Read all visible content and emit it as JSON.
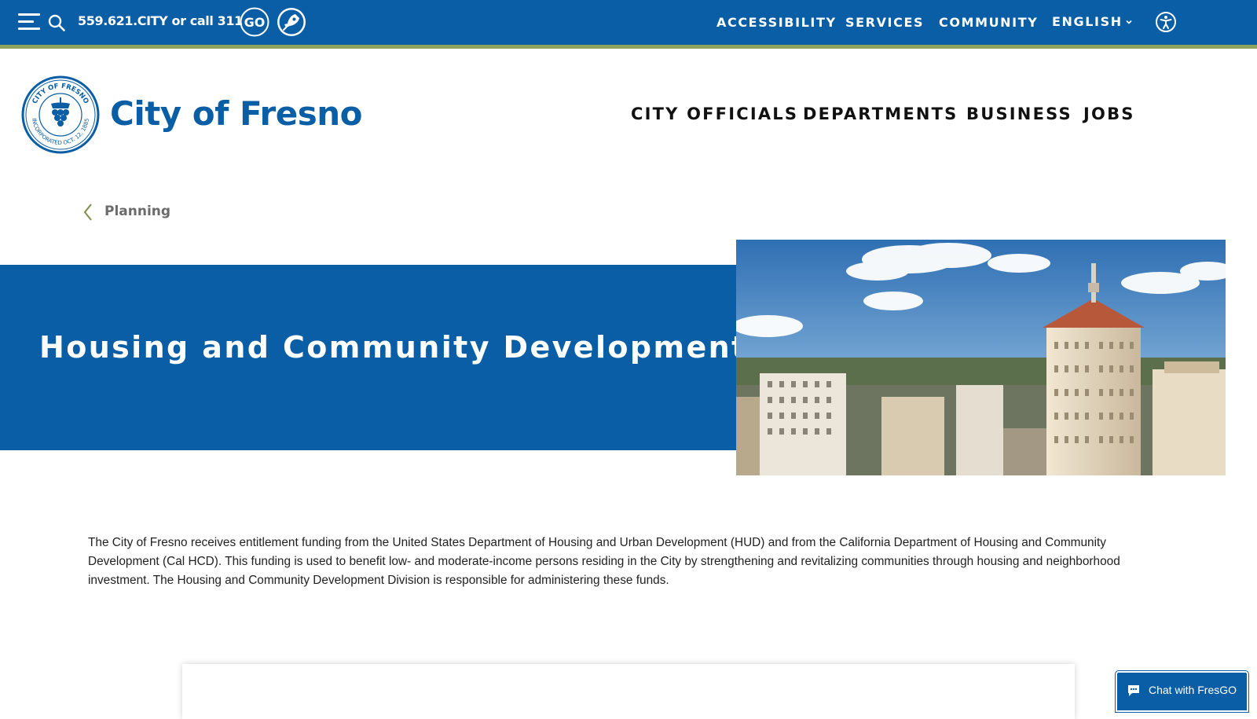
{
  "topbar": {
    "phone_text": "559.621.CITY or call 311",
    "utility_links": [
      "ACCESSIBILITY",
      "SERVICES",
      "COMMUNITY"
    ],
    "language": "ENGLISH",
    "icons": [
      "menu-icon",
      "search-icon",
      "go-icon",
      "rocket-icon",
      "chevron-down-icon",
      "accessibility-icon"
    ],
    "go_text": "GO"
  },
  "header": {
    "site_title": "City of Fresno",
    "seal_text_top": "CITY OF FRESNO",
    "seal_text_bottom": "INCORPORATED OCT. 12, 1885",
    "nav": [
      "CITY OFFICIALS",
      "DEPARTMENTS",
      "BUSINESS",
      "JOBS"
    ]
  },
  "breadcrumb": {
    "parent": "Planning"
  },
  "hero": {
    "title": "Housing and Community Development"
  },
  "main": {
    "intro": "The City of Fresno receives entitlement funding from the United States Department of Housing and Urban Development (HUD) and from the California Department of Housing and Community Development (Cal HCD). This funding is used to benefit low- and moderate-income persons residing in the City by strengthening and revitalizing communities through housing and neighborhood investment. The Housing and Community Development Division is responsible for administering these funds."
  },
  "chat": {
    "label": "Chat with FresGO"
  },
  "colors": {
    "brand_blue": "#0a5ea5",
    "stripe_green": "#8fa45e",
    "breadcrumb_gray": "#6b6b6b"
  }
}
